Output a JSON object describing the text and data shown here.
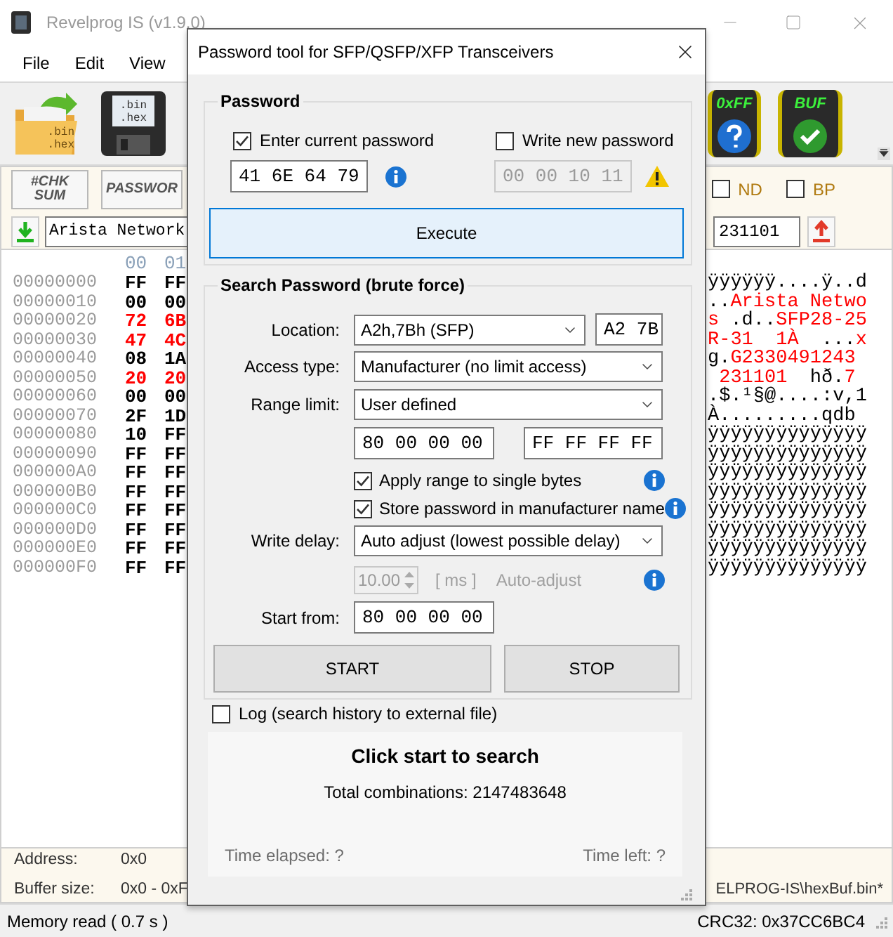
{
  "window": {
    "title": "Revelprog IS (v1.9.0)"
  },
  "menu": [
    "File",
    "Edit",
    "View"
  ],
  "toolbar": [
    {
      "kind": "open",
      "caption": [
        ".bin",
        ".hex"
      ]
    },
    {
      "kind": "save",
      "caption": [
        ".bin",
        ".hex"
      ]
    },
    {
      "kind": "erase_check",
      "caption": [
        "0xFF"
      ]
    },
    {
      "kind": "buffer_check",
      "caption": [
        "BUF"
      ]
    }
  ],
  "tools_panel": {
    "buttons": [
      {
        "kind": "checksum",
        "caption": [
          "#CHK",
          "SUM"
        ]
      },
      {
        "kind": "password",
        "caption": [
          "PASSWOR"
        ]
      }
    ],
    "flags": [
      {
        "label": "ND",
        "checked": false
      },
      {
        "label": "BP",
        "checked": false
      }
    ],
    "vendor_field": {
      "value": "Arista Network"
    },
    "date_field": {
      "value": "231101"
    }
  },
  "hex_view": {
    "header": [
      "00",
      "01"
    ],
    "rows": [
      {
        "address": "00000000",
        "bytes": [
          "FF",
          "FF"
        ],
        "highlighted": false,
        "ascii": [
          {
            "text": "ÿÿÿÿÿÿ....ÿ..d",
            "highlighted": false
          }
        ]
      },
      {
        "address": "00000010",
        "bytes": [
          "00",
          "00"
        ],
        "highlighted": false,
        "ascii": [
          {
            "text": "..",
            "highlighted": false
          },
          {
            "text": "Arista Netwo",
            "highlighted": true
          }
        ]
      },
      {
        "address": "00000020",
        "bytes": [
          "72",
          "6B"
        ],
        "highlighted": true,
        "ascii": [
          {
            "text": "s",
            "highlighted": true
          },
          {
            "text": " .d..",
            "highlighted": false
          },
          {
            "text": "SFP28-25",
            "highlighted": true
          }
        ]
      },
      {
        "address": "00000030",
        "bytes": [
          "47",
          "4C"
        ],
        "highlighted": true,
        "ascii": [
          {
            "text": "R-31  1À",
            "highlighted": true
          },
          {
            "text": "  ...",
            "highlighted": false
          },
          {
            "text": "x",
            "highlighted": true
          }
        ]
      },
      {
        "address": "00000040",
        "bytes": [
          "08",
          "1A"
        ],
        "highlighted": false,
        "ascii": [
          {
            "text": "g.",
            "highlighted": false
          },
          {
            "text": "G2330491243",
            "highlighted": true
          }
        ]
      },
      {
        "address": "00000050",
        "bytes": [
          "20",
          "20"
        ],
        "highlighted": true,
        "ascii": [
          {
            "text": " 231101",
            "highlighted": true
          },
          {
            "text": "  hð.",
            "highlighted": false
          },
          {
            "text": "7",
            "highlighted": true
          }
        ]
      },
      {
        "address": "00000060",
        "bytes": [
          "00",
          "00"
        ],
        "highlighted": false,
        "ascii": [
          {
            "text": ".$.¹§@....:v,1",
            "highlighted": false
          }
        ]
      },
      {
        "address": "00000070",
        "bytes": [
          "2F",
          "1D"
        ],
        "highlighted": false,
        "ascii": [
          {
            "text": "À.........qdb",
            "highlighted": false
          }
        ]
      },
      {
        "address": "00000080",
        "bytes": [
          "10",
          "FF"
        ],
        "highlighted": false,
        "ascii": [
          {
            "text": "ÿÿÿÿÿÿÿÿÿÿÿÿÿÿ",
            "highlighted": false
          }
        ]
      },
      {
        "address": "00000090",
        "bytes": [
          "FF",
          "FF"
        ],
        "highlighted": false,
        "ascii": [
          {
            "text": "ÿÿÿÿÿÿÿÿÿÿÿÿÿÿ",
            "highlighted": false
          }
        ]
      },
      {
        "address": "000000A0",
        "bytes": [
          "FF",
          "FF"
        ],
        "highlighted": false,
        "ascii": [
          {
            "text": "ÿÿÿÿÿÿÿÿÿÿÿÿÿÿ",
            "highlighted": false
          }
        ]
      },
      {
        "address": "000000B0",
        "bytes": [
          "FF",
          "FF"
        ],
        "highlighted": false,
        "ascii": [
          {
            "text": "ÿÿÿÿÿÿÿÿÿÿÿÿÿÿ",
            "highlighted": false
          }
        ]
      },
      {
        "address": "000000C0",
        "bytes": [
          "FF",
          "FF"
        ],
        "highlighted": false,
        "ascii": [
          {
            "text": "ÿÿÿÿÿÿÿÿÿÿÿÿÿÿ",
            "highlighted": false
          }
        ]
      },
      {
        "address": "000000D0",
        "bytes": [
          "FF",
          "FF"
        ],
        "highlighted": false,
        "ascii": [
          {
            "text": "ÿÿÿÿÿÿÿÿÿÿÿÿÿÿ",
            "highlighted": false
          }
        ]
      },
      {
        "address": "000000E0",
        "bytes": [
          "FF",
          "FF"
        ],
        "highlighted": false,
        "ascii": [
          {
            "text": "ÿÿÿÿÿÿÿÿÿÿÿÿÿÿ",
            "highlighted": false
          }
        ]
      },
      {
        "address": "000000F0",
        "bytes": [
          "FF",
          "FF"
        ],
        "highlighted": false,
        "ascii": [
          {
            "text": "ÿÿÿÿÿÿÿÿÿÿÿÿÿÿ",
            "highlighted": false
          }
        ]
      }
    ]
  },
  "info_panel": {
    "address_label": "Address:",
    "address": "0x0",
    "buffer_label": "Buffer size:",
    "buffer": "0x0 - 0xF",
    "path": "ELPROG-IS\\hexBuf.bin*"
  },
  "status_bar": {
    "left": "Memory read ( 0.7 s )",
    "right": "CRC32: 0x37CC6BC4"
  },
  "dialog": {
    "title": "Password tool for SFP/QSFP/XFP Transceivers",
    "password": {
      "title": "Password",
      "current": {
        "label": "Enter current password",
        "checked": true,
        "value": "41 6E 64 79"
      },
      "new": {
        "label": "Write new password",
        "checked": false,
        "value": "00 00 10 11"
      },
      "execute": {
        "label": "Execute",
        "hovered": true
      }
    },
    "search": {
      "title": "Search Password (brute force)",
      "location": {
        "label": "Location:",
        "value": "A2h,7Bh (SFP)",
        "address": "A2 7B"
      },
      "access_type": {
        "label": "Access type:",
        "value": "Manufacturer (no limit access)"
      },
      "range_limit": {
        "label": "Range limit:",
        "value": "User defined",
        "from": "80 00 00 00",
        "to": "FF FF FF FF"
      },
      "options": [
        {
          "label": "Apply range to single bytes",
          "checked": true
        },
        {
          "label": "Store password in manufacturer name",
          "checked": true
        }
      ],
      "write_delay": {
        "label": "Write delay:",
        "value": "Auto adjust (lowest possible delay)",
        "delay": "10.00",
        "unit": "[ ms ]",
        "mode": "Auto-adjust",
        "disabled": true
      },
      "start_from": {
        "label": "Start from:",
        "value": "80 00 00 00"
      },
      "start": "START",
      "stop": "STOP"
    },
    "log": {
      "label": "Log (search history to external file)",
      "checked": false
    },
    "result": {
      "message": "Click start to search",
      "total": "Total combinations: 2147483648",
      "elapsed": "Time elapsed: ?",
      "left": "Time left: ?"
    }
  }
}
